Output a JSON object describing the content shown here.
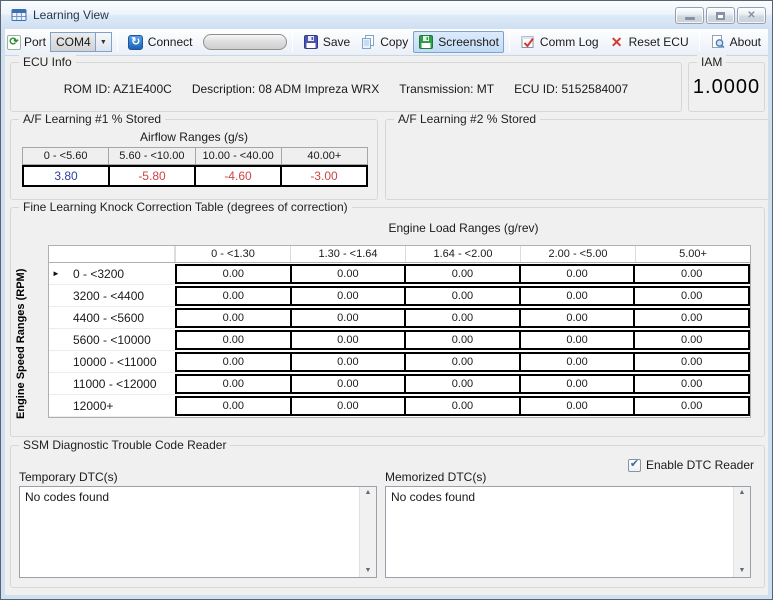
{
  "window": {
    "title": "Learning View"
  },
  "toolbar": {
    "port_label": "Port",
    "port_value": "COM4",
    "connect_label": "Connect",
    "save_label": "Save",
    "copy_label": "Copy",
    "screenshot_label": "Screenshot",
    "comm_log_label": "Comm Log",
    "reset_ecu_label": "Reset ECU",
    "about_label": "About"
  },
  "ecu_info": {
    "label": "ECU Info",
    "fields": [
      "ROM ID: AZ1E400C",
      "Description: 08 ADM Impreza WRX",
      "Transmission: MT",
      "ECU ID: 5152584007"
    ]
  },
  "iam": {
    "label": "IAM",
    "value": "1.0000"
  },
  "af_learning_1": {
    "label": "A/F Learning #1 % Stored",
    "axis_label": "Airflow Ranges (g/s)",
    "columns": [
      "0 - <5.60",
      "5.60 - <10.00",
      "10.00 - <40.00",
      "40.00+"
    ],
    "values": [
      "3.80",
      "-5.80",
      "-4.60",
      "-3.00"
    ]
  },
  "af_learning_2": {
    "label": "A/F Learning #2 % Stored"
  },
  "knock_table": {
    "label": "Fine Learning Knock Correction Table (degrees of correction)",
    "load_axis_label": "Engine Load Ranges (g/rev)",
    "rpm_axis_label": "Engine Speed Ranges (RPM)",
    "columns": [
      "0 - <1.30",
      "1.30 - <1.64",
      "1.64 - <2.00",
      "2.00 - <5.00",
      "5.00+"
    ],
    "rows": [
      "0 - <3200",
      "3200 - <4400",
      "4400 - <5600",
      "5600 - <10000",
      "10000 - <11000",
      "11000 - <12000",
      "12000+"
    ],
    "values": [
      [
        "0.00",
        "0.00",
        "0.00",
        "0.00",
        "0.00"
      ],
      [
        "0.00",
        "0.00",
        "0.00",
        "0.00",
        "0.00"
      ],
      [
        "0.00",
        "0.00",
        "0.00",
        "0.00",
        "0.00"
      ],
      [
        "0.00",
        "0.00",
        "0.00",
        "0.00",
        "0.00"
      ],
      [
        "0.00",
        "0.00",
        "0.00",
        "0.00",
        "0.00"
      ],
      [
        "0.00",
        "0.00",
        "0.00",
        "0.00",
        "0.00"
      ],
      [
        "0.00",
        "0.00",
        "0.00",
        "0.00",
        "0.00"
      ]
    ]
  },
  "dtc_reader": {
    "label": "SSM Diagnostic Trouble Code Reader",
    "temporary_label": "Temporary DTC(s)",
    "memorized_label": "Memorized DTC(s)",
    "enable_label": "Enable DTC Reader",
    "enable_checked": true,
    "temporary_text": "No codes found",
    "memorized_text": "No codes found"
  },
  "colors": {
    "positive_value": "#2f3f9f",
    "negative_value": "#cc4540",
    "selection_highlight": "#cfe4fa",
    "titlebar_top": "#fbfdfe",
    "titlebar_bottom": "#cfdff2"
  }
}
